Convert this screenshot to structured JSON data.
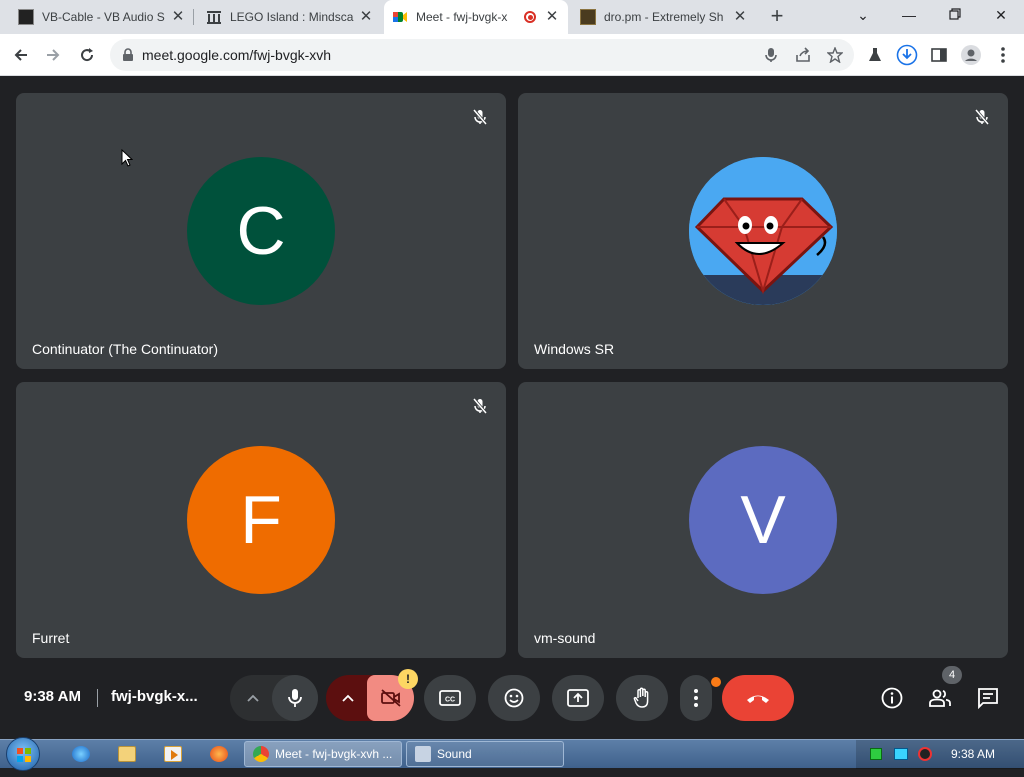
{
  "browser": {
    "tabs": [
      {
        "title": "VB-Cable - VB Audio S",
        "active": false
      },
      {
        "title": "LEGO Island : Mindsca",
        "active": false
      },
      {
        "title": "Meet - fwj-bvgk-x",
        "active": true
      },
      {
        "title": "dro.pm - Extremely Sh",
        "active": false
      }
    ],
    "url": "meet.google.com/fwj-bvgk-xvh"
  },
  "meet": {
    "participants": [
      {
        "name": "Continuator (The Continuator)",
        "initial": "C",
        "color": "#00513b",
        "muted": true
      },
      {
        "name": "Windows SR",
        "initial": "",
        "color": "#3aa0f0",
        "muted": true
      },
      {
        "name": "Furret",
        "initial": "F",
        "color": "#ef6c00",
        "muted": true
      },
      {
        "name": "vm-sound",
        "initial": "V",
        "color": "#5c6bc0",
        "muted": false
      }
    ],
    "time": "9:38 AM",
    "meeting_code": "fwj-bvgk-x...",
    "camera_warning": "!",
    "people_count": "4"
  },
  "taskbar": {
    "windows": [
      {
        "label": "Meet - fwj-bvgk-xvh ...",
        "active": true
      },
      {
        "label": "Sound",
        "active": false
      }
    ],
    "clock": "9:38 AM"
  },
  "colors": {
    "end_call": "#ea4335",
    "camera_off": "#f28b82",
    "camera_off_dark": "#5c0f0f",
    "accent_blue": "#1a73e8"
  }
}
